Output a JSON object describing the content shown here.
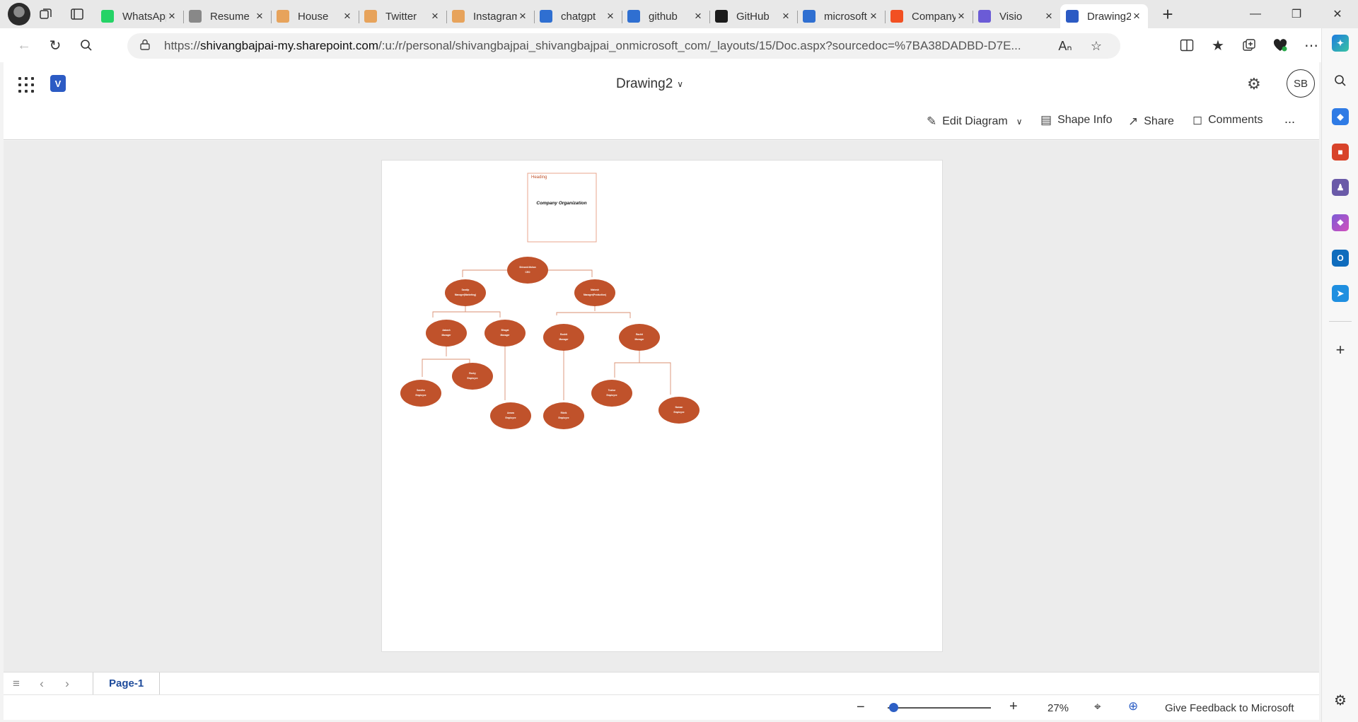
{
  "browser": {
    "tabs": [
      {
        "title": "WhatsApp",
        "icon": "whatsapp-icon",
        "color": "#25d366"
      },
      {
        "title": "Resume",
        "icon": "document-icon",
        "color": "#888888"
      },
      {
        "title": "House",
        "icon": "link-icon",
        "color": "#e7a35b"
      },
      {
        "title": "Twitter",
        "icon": "link-icon",
        "color": "#e7a35b"
      },
      {
        "title": "Instagram",
        "icon": "link-icon",
        "color": "#e7a35b"
      },
      {
        "title": "chatgpt",
        "icon": "search-icon",
        "color": "#2f6fd1"
      },
      {
        "title": "github",
        "icon": "search-icon",
        "color": "#2f6fd1"
      },
      {
        "title": "GitHub",
        "icon": "github-icon",
        "color": "#1b1b1b"
      },
      {
        "title": "microsoft",
        "icon": "search-icon",
        "color": "#2f6fd1"
      },
      {
        "title": "Company",
        "icon": "microsoft-icon",
        "color": "#f25022"
      },
      {
        "title": "Visio",
        "icon": "copilot-icon",
        "color": "#6b5bd6"
      },
      {
        "title": "Drawing2",
        "icon": "visio-icon",
        "color": "#2c5bc4"
      }
    ],
    "url_prefix": "https://",
    "url_host": "shivangbajpai-my.sharepoint.com",
    "url_path": "/:u:/r/personal/shivangbajpai_shivangbajpai_onmicrosoft_com/_layouts/15/Doc.aspx?sourcedoc=%7BA38DADBD-D7E..."
  },
  "app": {
    "document_title": "Drawing2",
    "avatar_initials": "SB",
    "commands": {
      "edit_diagram": "Edit Diagram",
      "shape_info": "Shape Info",
      "share": "Share",
      "comments": "Comments",
      "more": "..."
    }
  },
  "diagram": {
    "heading_label": "Heading",
    "heading_title": "Company Organization",
    "shape_fill": "#c0522b",
    "nodes": [
      {
        "id": "ceo",
        "name": "Shivank Mohan",
        "role": "CEO"
      },
      {
        "id": "m1",
        "name": "Sandip",
        "role": "Manager(Marketing)"
      },
      {
        "id": "m2",
        "name": "Mahesh",
        "role": "Manager(Production)"
      },
      {
        "id": "a",
        "name": "Aakash",
        "role": "Manager"
      },
      {
        "id": "b",
        "name": "Bhagat",
        "role": "Manager"
      },
      {
        "id": "c",
        "name": "Roshit",
        "role": "Manager"
      },
      {
        "id": "d",
        "name": "Rachit",
        "role": "Manager"
      },
      {
        "id": "e1",
        "name": "Sandhu",
        "role": "Employee"
      },
      {
        "id": "e2",
        "name": "Rocky",
        "role": "Employee"
      },
      {
        "id": "e3",
        "name": "Amara",
        "role": "Employee"
      },
      {
        "id": "e4",
        "name": "Ritvik",
        "role": "Employee"
      },
      {
        "id": "e5",
        "name": "Tushar",
        "role": "Employee"
      },
      {
        "id": "e6",
        "name": "Naman",
        "role": "Employee"
      }
    ]
  },
  "footer": {
    "page_tab": "Page-1",
    "zoom": "27%",
    "zoom_level": 0.03,
    "feedback": "Give Feedback to Microsoft"
  }
}
